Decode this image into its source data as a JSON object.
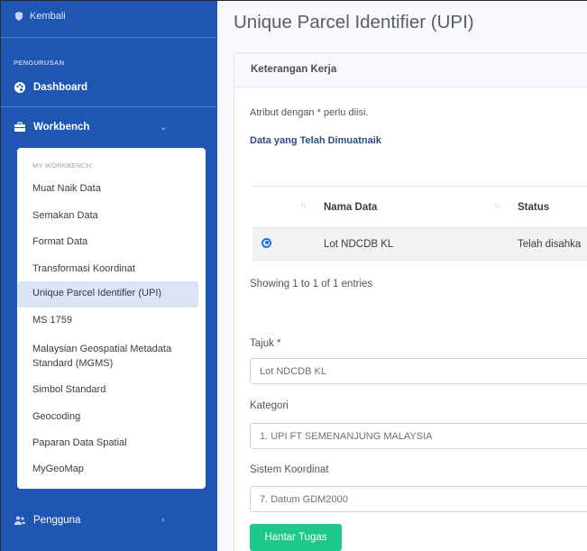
{
  "sidebar": {
    "back_label": "Kembali",
    "section_heading": "PENGURUSAN",
    "dashboard_label": "Dashboard",
    "workbench_label": "Workbench",
    "submenu_heading": "MY WORKBENCH:",
    "items": [
      {
        "label": "Muat Naik Data"
      },
      {
        "label": "Semakan Data"
      },
      {
        "label": "Format Data"
      },
      {
        "label": "Transformasi Koordinat"
      },
      {
        "label": "Unique Parcel Identifier (UPI)",
        "active": true
      },
      {
        "label": "MS 1759"
      },
      {
        "label": "Malaysian Geospatial Metadata Standard (MGMS)"
      },
      {
        "label": "Simbol Standard"
      },
      {
        "label": "Geocoding"
      },
      {
        "label": "Paparan Data Spatial"
      },
      {
        "label": "MyGeoMap"
      }
    ],
    "pengguna_label": "Pengguna",
    "icons": {
      "back": "shield-icon",
      "dashboard": "palette-icon",
      "workbench": "briefcase-icon",
      "pengguna": "users-icon"
    },
    "bg_color": "#1f56b4"
  },
  "main": {
    "title": "Unique Parcel Identifier (UPI)",
    "card_header": "Keterangan Kerja",
    "note": "Atribut dengan * perlu diisi.",
    "uploaded_heading": "Data yang Telah Dimuatnaik",
    "table": {
      "columns": [
        "",
        "Nama Data",
        "Status"
      ],
      "rows": [
        {
          "selected": true,
          "nama_data": "Lot NDCDB KL",
          "status": "Telah disahka"
        }
      ]
    },
    "entries_info": "Showing 1 to 1 of 1 entries",
    "form": {
      "tajuk_label": "Tajuk *",
      "tajuk_value": "Lot NDCDB KL",
      "kategori_label": "Kategori",
      "kategori_value": "1. UPI FT SEMENANJUNG MALAYSIA",
      "sistem_label": "Sistem Koordinat",
      "sistem_value": "7. Datum GDM2000"
    },
    "submit_label": "Hantar Tugas",
    "accent_color": "#1cc88a"
  }
}
